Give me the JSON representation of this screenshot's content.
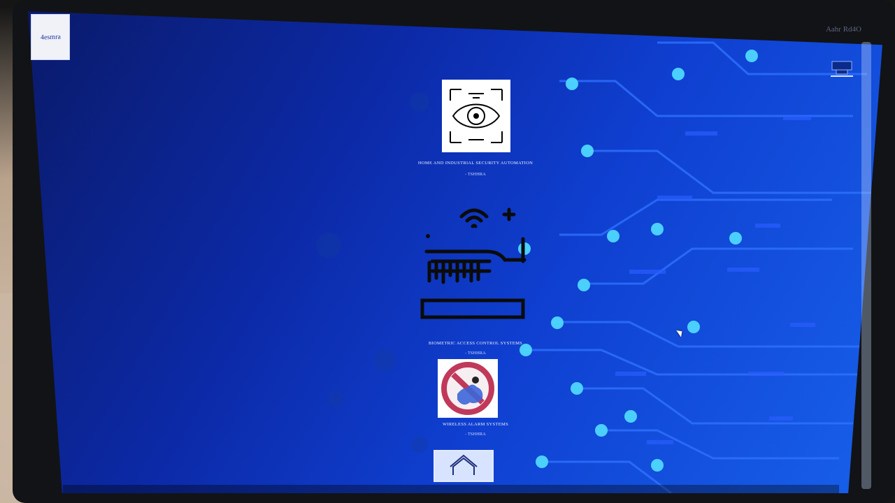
{
  "brand": {
    "logo_text": "4esmra"
  },
  "top_right_text": "Aahr Rd4O",
  "items": [
    {
      "title": "HOME AND INDUSTRIAL SECURITY AUTOMATION",
      "subtitle": "- TSHHRA"
    },
    {
      "title": "BIOMETRIC ACCESS CONTROL SYSTEMS",
      "subtitle": "- TSHHRA"
    },
    {
      "title": "WIRELESS ALARM SYSTEMS",
      "subtitle": "- TSHHRA"
    }
  ],
  "colors": {
    "screen_bg": "#0c2aa8",
    "accent": "#4fd7ff"
  },
  "icons": {
    "logo": "logo-mark",
    "security_automation": "eye-scan-icon",
    "biometric_access": "fingerprint-hand-icon",
    "wireless_alarm": "burglar-prohibited-icon",
    "next_item": "house-icon"
  }
}
